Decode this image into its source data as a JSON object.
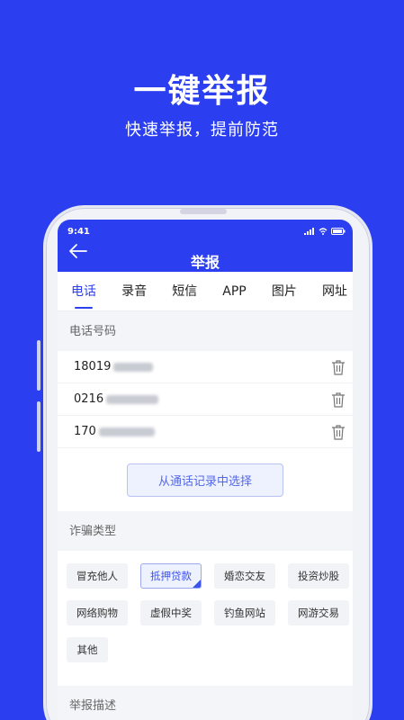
{
  "promo": {
    "title": "一键举报",
    "subtitle": "快速举报，提前防范"
  },
  "status_bar": {
    "time": "9:41",
    "icons": [
      "signal-icon",
      "wifi-icon",
      "battery-icon"
    ]
  },
  "nav": {
    "title": "举报",
    "back_icon": "arrow-left-icon"
  },
  "tabs": [
    {
      "label": "电话",
      "active": true
    },
    {
      "label": "录音",
      "active": false
    },
    {
      "label": "短信",
      "active": false
    },
    {
      "label": "APP",
      "active": false
    },
    {
      "label": "图片",
      "active": false
    },
    {
      "label": "网址",
      "active": false
    }
  ],
  "phone_section": {
    "title": "电话号码",
    "numbers": [
      {
        "visible_prefix": "18019"
      },
      {
        "visible_prefix": "0216"
      },
      {
        "visible_prefix": "170"
      }
    ],
    "choose_button": "从通话记录中选择"
  },
  "fraud_section": {
    "title": "诈骗类型",
    "types": [
      {
        "label": "冒充他人",
        "selected": false
      },
      {
        "label": "抵押贷款",
        "selected": true
      },
      {
        "label": "婚恋交友",
        "selected": false
      },
      {
        "label": "投资炒股",
        "selected": false
      },
      {
        "label": "网络购物",
        "selected": false
      },
      {
        "label": "虚假中奖",
        "selected": false
      },
      {
        "label": "钓鱼网站",
        "selected": false
      },
      {
        "label": "网游交易",
        "selected": false
      },
      {
        "label": "其他",
        "selected": false
      }
    ]
  },
  "description_section": {
    "title": "举报描述"
  },
  "colors": {
    "brand": "#2c3ff0",
    "accent_light": "#eef1fe"
  }
}
